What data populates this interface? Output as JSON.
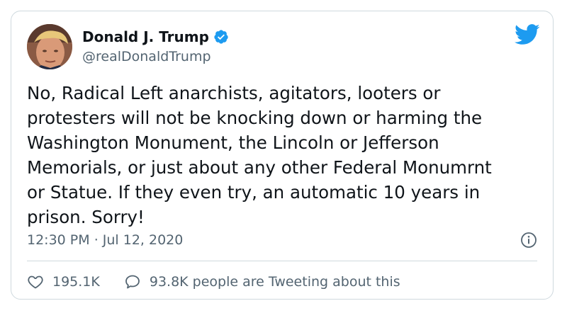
{
  "tweet": {
    "author_name": "Donald J. Trump",
    "handle": "@realDonaldTrump",
    "text": "No, Radical Left anarchists, agitators, looters or\nprotesters will not be knocking down or harming the\nWashington Monument, the Lincoln or Jefferson\nMemorials, or just about any other Federal Monumrnt\nor Statue. If they even try, an automatic 10 years in\nprison. Sorry!",
    "time": "12:30 PM",
    "date": "Jul 12, 2020",
    "separator": " · ",
    "likes": "195.1K",
    "conversation": "93.8K people are Tweeting about this"
  },
  "icons": {
    "verified": "verified-badge-icon",
    "brand": "twitter-bird-icon",
    "info": "info-icon",
    "like": "heart-icon",
    "reply": "speech-bubble-icon"
  },
  "colors": {
    "brand_blue": "#1d9bf0",
    "text": "#0f1419",
    "muted": "#536471",
    "border": "#cfd9de"
  }
}
